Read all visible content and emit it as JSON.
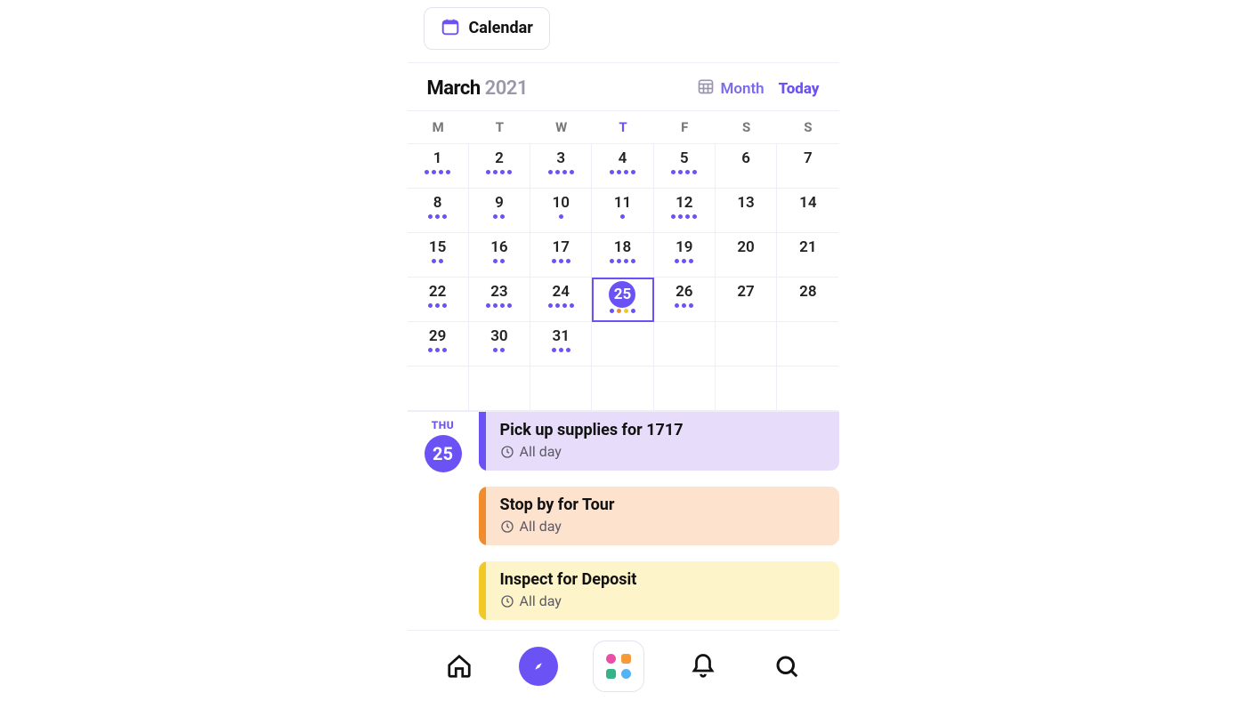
{
  "tab": {
    "label": "Calendar"
  },
  "header": {
    "month": "March",
    "year": "2021",
    "view_label": "Month",
    "today_label": "Today"
  },
  "dow": [
    "M",
    "T",
    "W",
    "T",
    "F",
    "S",
    "S"
  ],
  "selected_day": 25,
  "today_dow_index": 3,
  "days": [
    {
      "n": 1,
      "dots": [
        "p",
        "p",
        "p",
        "p"
      ]
    },
    {
      "n": 2,
      "dots": [
        "p",
        "p",
        "p",
        "p"
      ]
    },
    {
      "n": 3,
      "dots": [
        "p",
        "p",
        "p",
        "p"
      ]
    },
    {
      "n": 4,
      "dots": [
        "p",
        "p",
        "p",
        "p"
      ]
    },
    {
      "n": 5,
      "dots": [
        "p",
        "p",
        "p",
        "p"
      ]
    },
    {
      "n": 6,
      "dots": []
    },
    {
      "n": 7,
      "dots": []
    },
    {
      "n": 8,
      "dots": [
        "p",
        "p",
        "p"
      ]
    },
    {
      "n": 9,
      "dots": [
        "p",
        "p"
      ]
    },
    {
      "n": 10,
      "dots": [
        "p"
      ]
    },
    {
      "n": 11,
      "dots": [
        "p"
      ]
    },
    {
      "n": 12,
      "dots": [
        "p",
        "p",
        "p",
        "p"
      ]
    },
    {
      "n": 13,
      "dots": []
    },
    {
      "n": 14,
      "dots": []
    },
    {
      "n": 15,
      "dots": [
        "p",
        "p"
      ]
    },
    {
      "n": 16,
      "dots": [
        "p",
        "p"
      ]
    },
    {
      "n": 17,
      "dots": [
        "p",
        "p",
        "p"
      ]
    },
    {
      "n": 18,
      "dots": [
        "p",
        "p",
        "p",
        "p"
      ]
    },
    {
      "n": 19,
      "dots": [
        "p",
        "p",
        "p"
      ]
    },
    {
      "n": 20,
      "dots": []
    },
    {
      "n": 21,
      "dots": []
    },
    {
      "n": 22,
      "dots": [
        "p",
        "p",
        "p"
      ]
    },
    {
      "n": 23,
      "dots": [
        "p",
        "p",
        "p",
        "p"
      ]
    },
    {
      "n": 24,
      "dots": [
        "p",
        "p",
        "p",
        "p"
      ]
    },
    {
      "n": 25,
      "dots": [
        "p",
        "o",
        "y",
        "p"
      ]
    },
    {
      "n": 26,
      "dots": [
        "p",
        "p",
        "p"
      ]
    },
    {
      "n": 27,
      "dots": []
    },
    {
      "n": 28,
      "dots": []
    },
    {
      "n": 29,
      "dots": [
        "p",
        "p",
        "p"
      ]
    },
    {
      "n": 30,
      "dots": [
        "p",
        "p"
      ]
    },
    {
      "n": 31,
      "dots": [
        "p",
        "p",
        "p"
      ]
    },
    {
      "n": "",
      "dots": []
    },
    {
      "n": "",
      "dots": []
    },
    {
      "n": "",
      "dots": []
    },
    {
      "n": "",
      "dots": []
    },
    {
      "n": "",
      "dots": []
    },
    {
      "n": "",
      "dots": []
    },
    {
      "n": "",
      "dots": []
    },
    {
      "n": "",
      "dots": []
    },
    {
      "n": "",
      "dots": []
    },
    {
      "n": "",
      "dots": []
    },
    {
      "n": "",
      "dots": []
    }
  ],
  "day_label": {
    "dow": "THU",
    "num": "25"
  },
  "events": [
    {
      "title": "Pick up supplies for 1717",
      "time": "All day",
      "color": "purple"
    },
    {
      "title": "Stop by for Tour",
      "time": "All day",
      "color": "orange"
    },
    {
      "title": "Inspect for Deposit",
      "time": "All day",
      "color": "yellow"
    }
  ],
  "colors": {
    "p": "#6a52f5",
    "o": "#f08c2c",
    "y": "#f1c927"
  }
}
